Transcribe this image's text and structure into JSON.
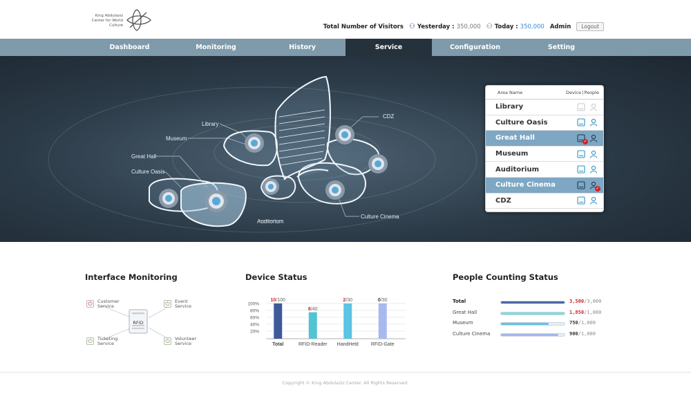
{
  "header": {
    "logo_line1": "King Abdulaziz",
    "logo_line2": "Center for World Culture",
    "visitors_label": "Total Number of Visitors",
    "yesterday_label": "Yesterday :",
    "yesterday_value": "350,000",
    "today_label": "Today :",
    "today_value": "350,000",
    "user": "Admin",
    "logout": "Logout"
  },
  "nav": [
    {
      "label": "Dashboard",
      "active": false
    },
    {
      "label": "Monitoring",
      "active": false
    },
    {
      "label": "History",
      "active": false
    },
    {
      "label": "Service",
      "active": true
    },
    {
      "label": "Configuration",
      "active": false
    },
    {
      "label": "Setting",
      "active": false
    }
  ],
  "map_labels": {
    "library": "Library",
    "museum": "Museum",
    "great_hall": "Great Hall",
    "culture_oasis": "Culture Oasis",
    "cdz": "CDZ",
    "auditorium": "Auditorium",
    "culture_cinema": "Culture Cinema"
  },
  "area_panel": {
    "col_area": "Area Name",
    "col_device": "Device",
    "col_sep": "|",
    "col_people": "People",
    "rows": [
      {
        "name": "Library",
        "state": "inactive"
      },
      {
        "name": "Culture Oasis",
        "state": "normal"
      },
      {
        "name": "Great Hall",
        "state": "selected-alert-device"
      },
      {
        "name": "Museum",
        "state": "normal"
      },
      {
        "name": "Auditorium",
        "state": "normal"
      },
      {
        "name": "Culture Cinema",
        "state": "selected-alert-people"
      },
      {
        "name": "CDZ",
        "state": "normal"
      }
    ]
  },
  "interface_monitoring": {
    "title": "Interface Monitoring",
    "center": "RFID",
    "customer_service": [
      "Customer",
      "Service"
    ],
    "event_service": [
      "Event",
      "Service"
    ],
    "ticketing_service": [
      "Ticketing",
      "Service"
    ],
    "volunteer_service": [
      "Volunteer",
      "Service"
    ]
  },
  "device_status": {
    "title": "Device Status"
  },
  "chart_data": {
    "type": "bar",
    "categories": [
      "Total",
      "RFID-Reader",
      "HandHeld",
      "RFID-Gate"
    ],
    "values_percent": [
      100,
      75,
      100,
      100
    ],
    "value_labels": [
      {
        "current": "10",
        "max": "/100"
      },
      {
        "current": "8",
        "max": "/40"
      },
      {
        "current": "2",
        "max": "/30"
      },
      {
        "current": "0",
        "max": "/30"
      }
    ],
    "y_ticks": [
      "100%",
      "80%",
      "60%",
      "40%",
      "20%"
    ],
    "ylim": [
      0,
      100
    ],
    "colors": [
      "#3e5a9a",
      "#53c4d2",
      "#5cc4e4",
      "#a9b9ef"
    ],
    "alert_color": "#d0232a"
  },
  "people_counting": {
    "title": "People Counting Status",
    "rows": [
      {
        "label": "Total",
        "current": "3,500",
        "max": "/3,000",
        "fraction": 1.0,
        "color": "#4b66a6",
        "alert": true,
        "bold": true
      },
      {
        "label": "Great Hall",
        "current": "1,850",
        "max": "/1,000",
        "fraction": 1.0,
        "color": "#7fdddb",
        "alert": true,
        "bold": false
      },
      {
        "label": "Museum",
        "current": "750",
        "max": "/1,000",
        "fraction": 0.75,
        "color": "#5fc4ea",
        "alert": false,
        "bold": false
      },
      {
        "label": "Culture Cinema",
        "current": "900",
        "max": "/1,000",
        "fraction": 0.9,
        "color": "#a4b6ec",
        "alert": false,
        "bold": false
      }
    ]
  },
  "footer": "Copyright © King Abdulaziz Center. All Rights Reserved."
}
